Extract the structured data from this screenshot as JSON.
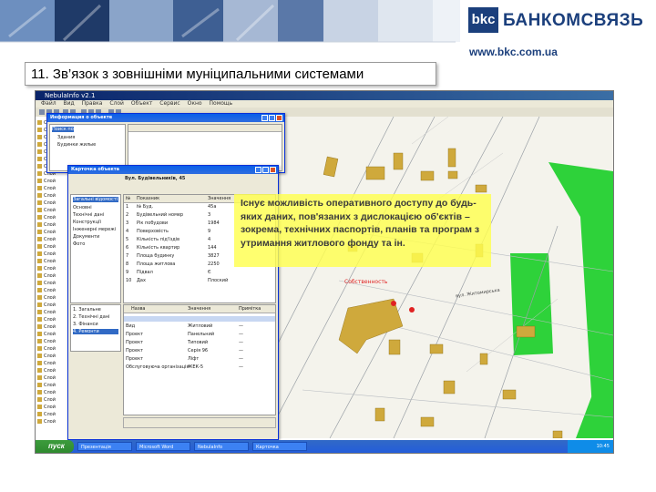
{
  "slide": {
    "title": "11. Зв’язок з зовнішніми муніципальними системами",
    "brand_mark": "bkc",
    "brand_name": "БАНКОМСВЯЗЬ",
    "brand_url": "www.bkc.com.ua",
    "callout": "Існує можливість оперативного доступу до будь-яких даних, пов'язаних з дислокацією об'єктів – зокрема, технічних паспортів, планів та програм з утримання житлового фонду та ін."
  },
  "app": {
    "title": "NebulaInfo v2.1",
    "menu": [
      "Файл",
      "Вид",
      "Правка",
      "Слой",
      "Объект",
      "Сервис",
      "Окно",
      "Помощь"
    ],
    "object_label": "Собственность",
    "street_label": "вул. Житомирська",
    "left_panel_rows": [
      "Слой",
      "Слой",
      "Слой",
      "Слой",
      "Слой",
      "Слой",
      "Слой",
      "Слой",
      "Слой",
      "Слой",
      "Слой",
      "Слой",
      "Слой",
      "Слой",
      "Слой",
      "Слой",
      "Слой",
      "Слой",
      "Слой",
      "Слой",
      "Слой",
      "Слой",
      "Слой",
      "Слой",
      "Слой",
      "Слой",
      "Слой",
      "Слой",
      "Слой",
      "Слой",
      "Слой",
      "Слой",
      "Слой",
      "Слой",
      "Слой",
      "Слой",
      "Слой",
      "Слой",
      "Слой",
      "Слой",
      "Слой",
      "Слой"
    ],
    "window1": {
      "title": "Информация о объекте",
      "tree": [
        "Поиск по",
        "Здания",
        "Будинки жилые"
      ]
    },
    "window2": {
      "title": "Карточка объекта",
      "header": "Вул. Будівельників, 45",
      "sidebar": [
        "Загальні відомості",
        "Основні",
        "Технічні дані",
        "Конструкції",
        "Інженерні мережі",
        "Документи",
        "Фото"
      ],
      "columns": [
        "№",
        "Показник",
        "Значення"
      ],
      "rows": [
        {
          "n": "1",
          "label": "№ Буд.",
          "value": "45а"
        },
        {
          "n": "2",
          "label": "Будівельний номер",
          "value": "3"
        },
        {
          "n": "3",
          "label": "Рік побудови",
          "value": "1984"
        },
        {
          "n": "4",
          "label": "Поверховість",
          "value": "9"
        },
        {
          "n": "5",
          "label": "Кількість під'їздів",
          "value": "4"
        },
        {
          "n": "6",
          "label": "Кількість квартир",
          "value": "144"
        },
        {
          "n": "7",
          "label": "Площа будинку",
          "value": "3827"
        },
        {
          "n": "8",
          "label": "Площа житлова",
          "value": "2250"
        },
        {
          "n": "9",
          "label": "Підвал",
          "value": "Є"
        },
        {
          "n": "10",
          "label": "Дах",
          "value": "Плоский"
        }
      ],
      "lower_tabs": [
        "1. Загальне",
        "2. Технічні дані",
        "3. Фінанси",
        "4. Ремонти"
      ],
      "lower_columns": [
        "Назва",
        "Значення",
        "Примітка"
      ],
      "lower_rows": [
        {
          "a": "Вид",
          "b": "Житловий",
          "c": "—"
        },
        {
          "a": "Проект",
          "b": "Панельний",
          "c": "—"
        },
        {
          "a": "Проект",
          "b": "Типовий",
          "c": "—"
        },
        {
          "a": "Проект",
          "b": "Серія 96",
          "c": "—"
        },
        {
          "a": "Проект",
          "b": "Ліфт",
          "c": "—"
        },
        {
          "a": "Обслуговуюча організація",
          "b": "ЖЕК-5",
          "c": "—"
        }
      ]
    },
    "taskbar": {
      "start": "пуск",
      "tasks": [
        "Презентація",
        "Microsoft Word",
        "NebulaInfo",
        "Карточка"
      ],
      "clock": "10:45"
    }
  },
  "colors": {
    "brand": "#1b3f7c",
    "callout": "#ffff4f",
    "building": "#cfa93c",
    "green": "#2ed23a"
  }
}
